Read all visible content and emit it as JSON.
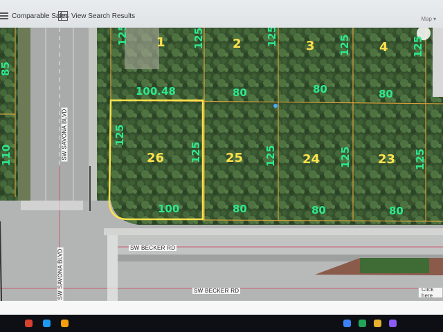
{
  "toolbar": {
    "comparable_sales_label": "Comparable Sales",
    "view_search_results_label": "View Search Results",
    "map_button_label": "Map"
  },
  "parcels": {
    "top_row": {
      "lot_1": "1",
      "lot_2": "2",
      "lot_3": "3",
      "lot_4": "4",
      "frontage_lot_1": "100.48",
      "frontage_lot_2": "80",
      "frontage_lot_3": "80",
      "frontage_lot_4": "80",
      "depth_lot_1_left": "125",
      "depth_lot_1_right": "125",
      "depth_lot_2_right": "125",
      "depth_lot_3_right": "125",
      "depth_lot_4_right": "125"
    },
    "bottom_row": {
      "lot_26": "26",
      "lot_25": "25",
      "lot_24": "24",
      "lot_23": "23",
      "frontage_lot_26": "100",
      "frontage_lot_25": "80",
      "frontage_lot_24": "80",
      "frontage_lot_23": "80",
      "depth_lot_26_left": "125",
      "depth_lot_26_right": "125",
      "depth_lot_25_right": "125",
      "depth_lot_24_right": "125",
      "depth_lot_23_right": "125"
    },
    "left_side": {
      "depth_upper": "85",
      "depth_lower": "110"
    }
  },
  "roads": {
    "savona_upper": "SW SAVONA BLVD",
    "savona_lower": "SW SAVONA BLVD",
    "becker_upper": "SW BECKER RD",
    "becker_lower": "SW BECKER RD"
  },
  "click_here_label": "Click here",
  "colors": {
    "dimension_label": "#2ee88f",
    "lot_number": "#ffe14d",
    "selected_outline": "#ffe14d",
    "parcel_line": "#d8a23a"
  },
  "icons": [
    "list-icon",
    "grid-icon",
    "chevron-down-icon"
  ]
}
